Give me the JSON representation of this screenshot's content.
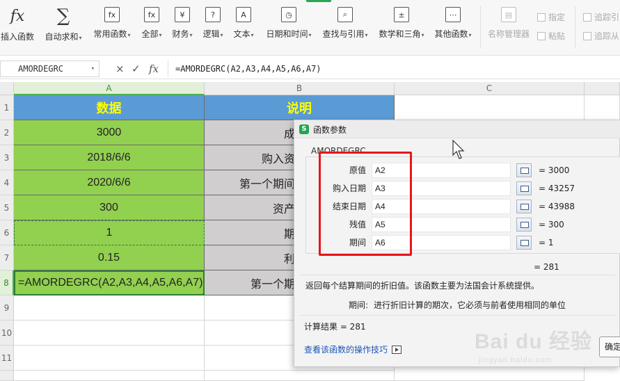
{
  "ribbon": {
    "items": [
      {
        "label": "插入函数",
        "icon": "fx-icon",
        "caret": false
      },
      {
        "label": "自动求和",
        "icon": "sigma-icon",
        "caret": true
      },
      {
        "label": "常用函数",
        "icon": "common-fx-icon",
        "caret": true
      },
      {
        "label": "全部",
        "icon": "all-fx-icon",
        "caret": true
      },
      {
        "label": "财务",
        "icon": "finance-icon",
        "caret": true
      },
      {
        "label": "逻辑",
        "icon": "logic-icon",
        "caret": true
      },
      {
        "label": "文本",
        "icon": "text-icon",
        "caret": true
      },
      {
        "label": "日期和时间",
        "icon": "clock-icon",
        "caret": true
      },
      {
        "label": "查找与引用",
        "icon": "lookup-icon",
        "caret": true
      },
      {
        "label": "数学和三角",
        "icon": "math-icon",
        "caret": true
      },
      {
        "label": "其他函数",
        "icon": "other-fx-icon",
        "caret": true
      },
      {
        "label": "名称管理器",
        "icon": "name-manager-icon",
        "caret": false
      }
    ],
    "small_items": [
      {
        "label": "指定",
        "icon": "specify-icon"
      },
      {
        "label": "粘贴",
        "icon": "paste-icon"
      },
      {
        "label": "追踪引",
        "icon": "trace-precedents-icon"
      },
      {
        "label": "追踪从",
        "icon": "trace-dependents-icon"
      }
    ],
    "sigma_glyph": "∑",
    "fx_glyph": "fx"
  },
  "formula_bar": {
    "name_box": "AMORDEGRC",
    "cancel_glyph": "×",
    "confirm_glyph": "✓",
    "fx_glyph": "fx",
    "formula": "=AMORDEGRC(A2,A3,A4,A5,A6,A7)"
  },
  "columns": [
    "A",
    "B",
    "C"
  ],
  "rows": [
    "1",
    "2",
    "3",
    "4",
    "5",
    "6",
    "7",
    "8",
    "9",
    "10",
    "11"
  ],
  "sheet": {
    "header_a": "数据",
    "header_b": "说明",
    "col_a": [
      "3000",
      "2018/6/6",
      "2020/6/6",
      "300",
      "1",
      "0.15",
      "=AMORDEGRC(A2,A3,A4,A5,A6,A7)"
    ],
    "col_b": [
      "成",
      "购入资",
      "第一个期间",
      "资产",
      "期",
      "利",
      "第一个期"
    ]
  },
  "dialog": {
    "title": "函数参数",
    "logo": "S",
    "function_name": "AMORDEGRC",
    "params": [
      {
        "label": "原值",
        "value": "A2",
        "result": "= 3000"
      },
      {
        "label": "购入日期",
        "value": "A3",
        "result": "= 43257"
      },
      {
        "label": "结束日期",
        "value": "A4",
        "result": "= 43988"
      },
      {
        "label": "残值",
        "value": "A5",
        "result": "= 300"
      },
      {
        "label": "期间",
        "value": "A6",
        "result": "= 1"
      }
    ],
    "formula_result": "= 281",
    "description": "返回每个结算期间的折旧值。该函数主要为法国会计系统提供。",
    "param_desc_name": "期间:",
    "param_desc_text": "进行折旧计算的期次，它必须与前者使用相同的单位",
    "calc_result": "计算结果 = 281",
    "help_link": "看该函数的操作技巧",
    "help_link_prefix": "查",
    "ok_label": "确定"
  },
  "watermark": {
    "main": "Bai du 经验",
    "sub": "jingyan.baidu.com"
  },
  "colors": {
    "header_blue": "#5b9bd5",
    "header_text": "#ffff00",
    "data_green": "#92d050",
    "desc_gray": "#d0cece",
    "highlight_red": "#e8141a",
    "link_blue": "#1a56b8"
  }
}
